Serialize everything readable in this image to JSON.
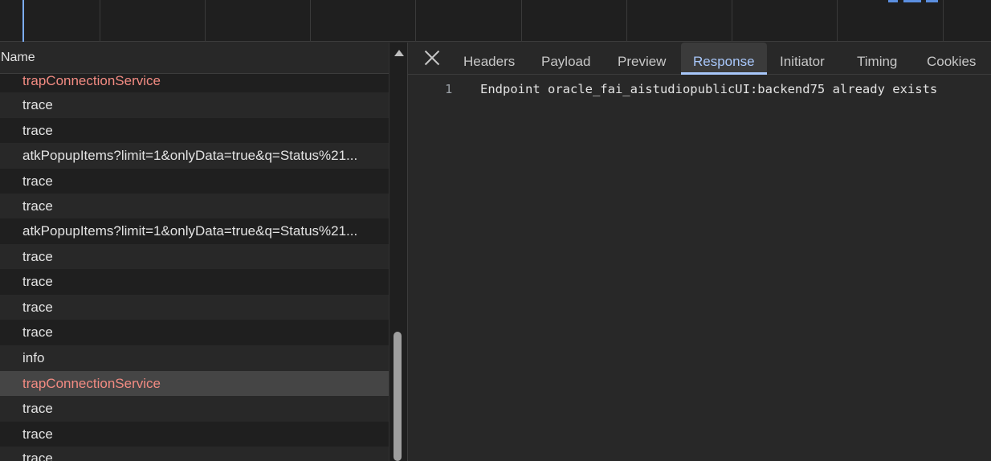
{
  "network_list": {
    "header": "Name",
    "rows": [
      {
        "label": "trapConnectionService",
        "error": true,
        "selected": false
      },
      {
        "label": "trace",
        "error": false,
        "selected": false
      },
      {
        "label": "trace",
        "error": false,
        "selected": false
      },
      {
        "label": "atkPopupItems?limit=1&onlyData=true&q=Status%21...",
        "error": false,
        "selected": false
      },
      {
        "label": "trace",
        "error": false,
        "selected": false
      },
      {
        "label": "trace",
        "error": false,
        "selected": false
      },
      {
        "label": "atkPopupItems?limit=1&onlyData=true&q=Status%21...",
        "error": false,
        "selected": false
      },
      {
        "label": "trace",
        "error": false,
        "selected": false
      },
      {
        "label": "trace",
        "error": false,
        "selected": false
      },
      {
        "label": "trace",
        "error": false,
        "selected": false
      },
      {
        "label": "trace",
        "error": false,
        "selected": false
      },
      {
        "label": "info",
        "error": false,
        "selected": false
      },
      {
        "label": "trapConnectionService",
        "error": true,
        "selected": true
      },
      {
        "label": "trace",
        "error": false,
        "selected": false
      },
      {
        "label": "trace",
        "error": false,
        "selected": false
      },
      {
        "label": "trace",
        "error": false,
        "selected": false
      }
    ]
  },
  "detail_tabs": [
    "Headers",
    "Payload",
    "Preview",
    "Response",
    "Initiator",
    "Timing",
    "Cookies"
  ],
  "active_tab": "Response",
  "response": {
    "line_number": "1",
    "text": "Endpoint oracle_fai_aistudiopublicUI:backend75 already exists"
  },
  "colors": {
    "error_text": "#f28b82",
    "active_tab": "#a8c7fa",
    "selected_row": "#454545"
  }
}
